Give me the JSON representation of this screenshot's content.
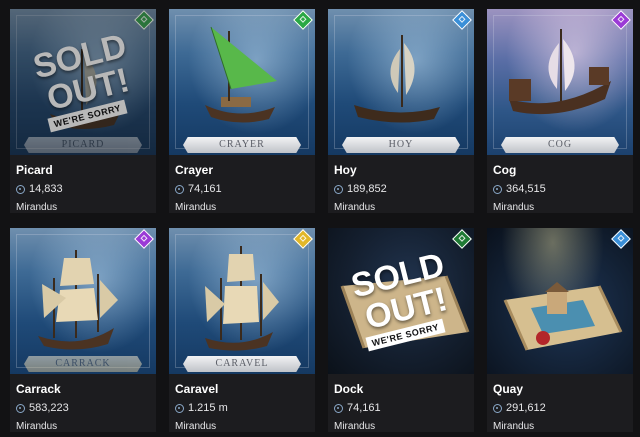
{
  "colors": {
    "background": "#121214",
    "card": "#1c1c1f",
    "rarity_common": "#2aa845",
    "rarity_rare": "#3a8fd8",
    "rarity_epic": "#9b3ad6",
    "rarity_legendary": "#e2b728",
    "uncommon_dark": "#1f7a34"
  },
  "sold_out": {
    "headline": "SOLD OUT!",
    "tagline": "WE'RE SORRY"
  },
  "items": [
    {
      "title": "Picard",
      "price": "14,833",
      "brand": "Mirandus",
      "plate": "PICARD",
      "rarity_color": "#2aa845",
      "sold_out": true
    },
    {
      "title": "Crayer",
      "price": "74,161",
      "brand": "Mirandus",
      "plate": "CRAYER",
      "rarity_color": "#2aa845",
      "sold_out": false
    },
    {
      "title": "Hoy",
      "price": "189,852",
      "brand": "Mirandus",
      "plate": "HOY",
      "rarity_color": "#3a8fd8",
      "sold_out": false
    },
    {
      "title": "Cog",
      "price": "364,515",
      "brand": "Mirandus",
      "plate": "COG",
      "rarity_color": "#9b3ad6",
      "sold_out": false
    },
    {
      "title": "Carrack",
      "price": "583,223",
      "brand": "Mirandus",
      "plate": "CARRACK",
      "rarity_color": "#9b3ad6",
      "sold_out": false
    },
    {
      "title": "Caravel",
      "price": "1.215 m",
      "brand": "Mirandus",
      "plate": "CARAVEL",
      "rarity_color": "#e2b728",
      "sold_out": false
    },
    {
      "title": "Dock",
      "price": "74,161",
      "brand": "Mirandus",
      "plate": "",
      "rarity_color": "#1f7a34",
      "sold_out": true
    },
    {
      "title": "Quay",
      "price": "291,612",
      "brand": "Mirandus",
      "plate": "",
      "rarity_color": "#3a8fd8",
      "sold_out": false
    }
  ]
}
